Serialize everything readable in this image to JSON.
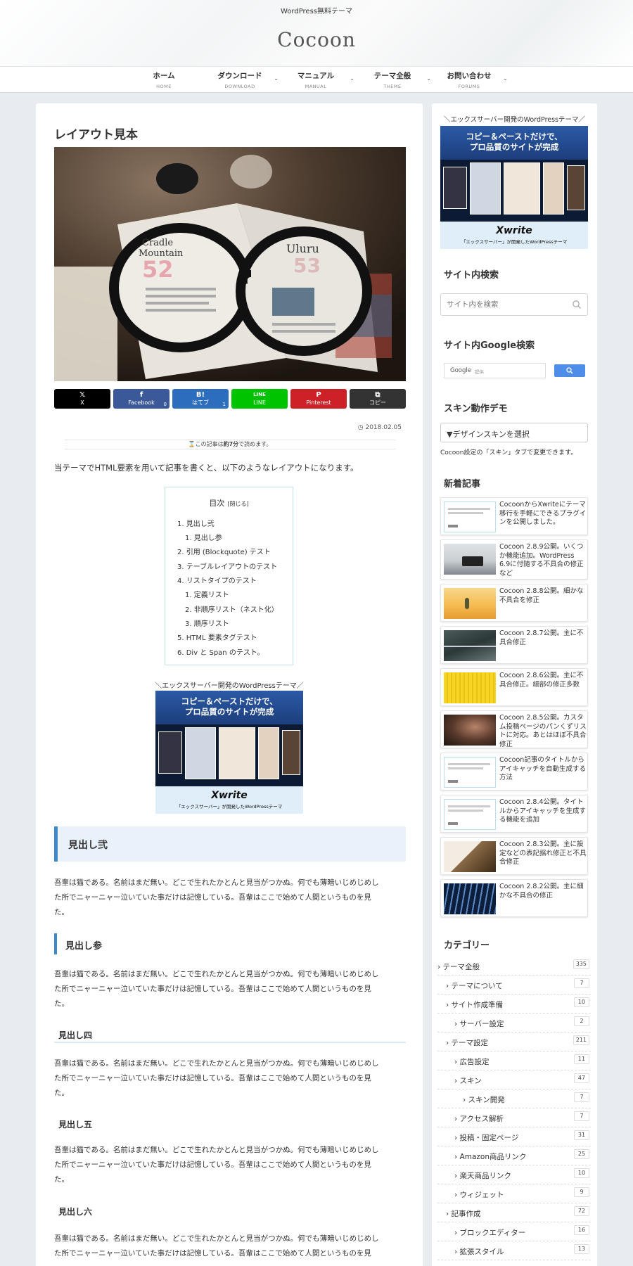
{
  "header": {
    "tagline": "WordPress無料テーマ",
    "site_name": "Cocoon"
  },
  "nav": [
    {
      "label": "ホーム",
      "sub": "HOME",
      "has_children": false
    },
    {
      "label": "ダウンロード",
      "sub": "DOWNLOAD",
      "has_children": true
    },
    {
      "label": "マニュアル",
      "sub": "MANUAL",
      "has_children": true
    },
    {
      "label": "テーマ全般",
      "sub": "THEME",
      "has_children": true
    },
    {
      "label": "お問い合わせ",
      "sub": "FORUMS",
      "has_children": true
    }
  ],
  "article": {
    "title": "レイアウト見本",
    "share_buttons": [
      {
        "icon": "𝕏",
        "label": "X",
        "count": "",
        "color": "#000000"
      },
      {
        "icon": "f",
        "label": "Facebook",
        "count": "0",
        "color": "#3b5998"
      },
      {
        "icon": "B!",
        "label": "はてブ",
        "count": "1",
        "color": "#2c6ebd"
      },
      {
        "icon": "LINE",
        "label": "LINE",
        "count": "",
        "color": "#00c300"
      },
      {
        "icon": "P",
        "label": "Pinterest",
        "count": "",
        "color": "#cc2127"
      },
      {
        "icon": "⧉",
        "label": "コピー",
        "count": "",
        "color": "#333333"
      }
    ],
    "date": "2018.02.05",
    "read_time": {
      "prefix": "この記事は",
      "minutes": "約7分",
      "suffix": "で読めます。"
    },
    "intro": "当テーマでHTML要素を用いて記事を書くと、以下のようなレイアウトになります。",
    "toc": {
      "title": "目次",
      "toggle": "[閉じる]",
      "items": [
        "1. 見出し弐",
        "1. 見出し参",
        "2. 引用 (Blockquote) テスト",
        "3. テーブルレイアウトのテスト",
        "4. リストタイプのテスト",
        "1. 定義リスト",
        "2. 非順序リスト（ネスト化）",
        "3. 順序リスト",
        "5. HTML 要素タグテスト",
        "6. Div と Span のテスト。"
      ]
    },
    "ad": {
      "caption": "＼エックスサーバー開発のWordPressテーマ／",
      "headline_1": "コピー＆ペーストだけで、",
      "headline_2": "プロ品質のサイトが完成",
      "logo": "Xwrite",
      "sub": "「エックスサーバー」が開発したWordPressテーマ"
    },
    "headings": {
      "h2": "見出し弐",
      "h3": "見出し参",
      "h4": "見出し四",
      "h5": "見出し五",
      "h6": "見出し六"
    },
    "paragraph_line1": "吾輩は猫である。名前はまだ無い。どこで生れたかとんと見当がつかぬ。何でも薄暗いじめじめし",
    "paragraph_line2": "た所でニャーニャー泣いていた事だけは記憶している。吾輩はここで始めて人間というものを見",
    "paragraph_line3": "た。"
  },
  "sidebar": {
    "ad": {
      "caption": "＼エックスサーバー開発のWordPressテーマ／",
      "headline_1": "コピー＆ペーストだけで、",
      "headline_2": "プロ品質のサイトが完成",
      "logo": "Xwrite",
      "sub": "「エックスサーバー」が開発したWordPressテーマ"
    },
    "search_title": "サイト内検索",
    "search_placeholder": "サイト内を検索",
    "google_title": "サイト内Google検索",
    "google_label": "Google",
    "google_sub": "提供",
    "skin_title": "スキン動作デモ",
    "skin_select": "▼デザインスキンを選択",
    "skin_note": "Cocoon設定の「スキン」タブで変更できます。",
    "recent_title": "新着記事",
    "recent_posts": [
      "CocoonからXwriteにテーマ移行を手軽にできるプラグインを公開しました。",
      "Cocoon 2.8.9公開。いくつか機能追加。WordPress 6.9に付随する不具合の修正など",
      "Cocoon 2.8.8公開。細かな不具合を修正",
      "Cocoon 2.8.7公開。主に不具合修正",
      "Cocoon 2.8.6公開。主に不具合修正。細部の修正多数",
      "Cocoon 2.8.5公開。カスタム投稿ページのパンくずリストに対応。あとはほぼ不具合修正",
      "Cocoon記事のタイトルからアイキャッチを自動生成する方法",
      "Cocoon 2.8.4公開。タイトルからアイキャッチを生成する機能を追加",
      "Cocoon 2.8.3公開。主に設定などの表記揺れ修正と不具合修正",
      "Cocoon 2.8.2公開。主に細かな不具合の修正"
    ],
    "category_title": "カテゴリー",
    "categories": [
      {
        "label": "テーマ全般",
        "count": "335",
        "level": 0
      },
      {
        "label": "テーマについて",
        "count": "7",
        "level": 1
      },
      {
        "label": "サイト作成準備",
        "count": "10",
        "level": 1
      },
      {
        "label": "サーバー設定",
        "count": "2",
        "level": 2
      },
      {
        "label": "テーマ設定",
        "count": "211",
        "level": 1
      },
      {
        "label": "広告設定",
        "count": "11",
        "level": 2
      },
      {
        "label": "スキン",
        "count": "47",
        "level": 2
      },
      {
        "label": "スキン開発",
        "count": "7",
        "level": 3
      },
      {
        "label": "アクセス解析",
        "count": "7",
        "level": 2
      },
      {
        "label": "投稿・固定ページ",
        "count": "31",
        "level": 2
      },
      {
        "label": "Amazon商品リンク",
        "count": "25",
        "level": 2
      },
      {
        "label": "楽天商品リンク",
        "count": "10",
        "level": 2
      },
      {
        "label": "ウィジェット",
        "count": "9",
        "level": 2
      },
      {
        "label": "記事作成",
        "count": "72",
        "level": 1
      },
      {
        "label": "ブロックエディター",
        "count": "16",
        "level": 2
      },
      {
        "label": "拡張スタイル",
        "count": "13",
        "level": 2
      }
    ]
  },
  "colors": {
    "accent": "#3c89cc",
    "heading_bg": "#e9f2fb",
    "page_bg": "#e8ecf0"
  }
}
